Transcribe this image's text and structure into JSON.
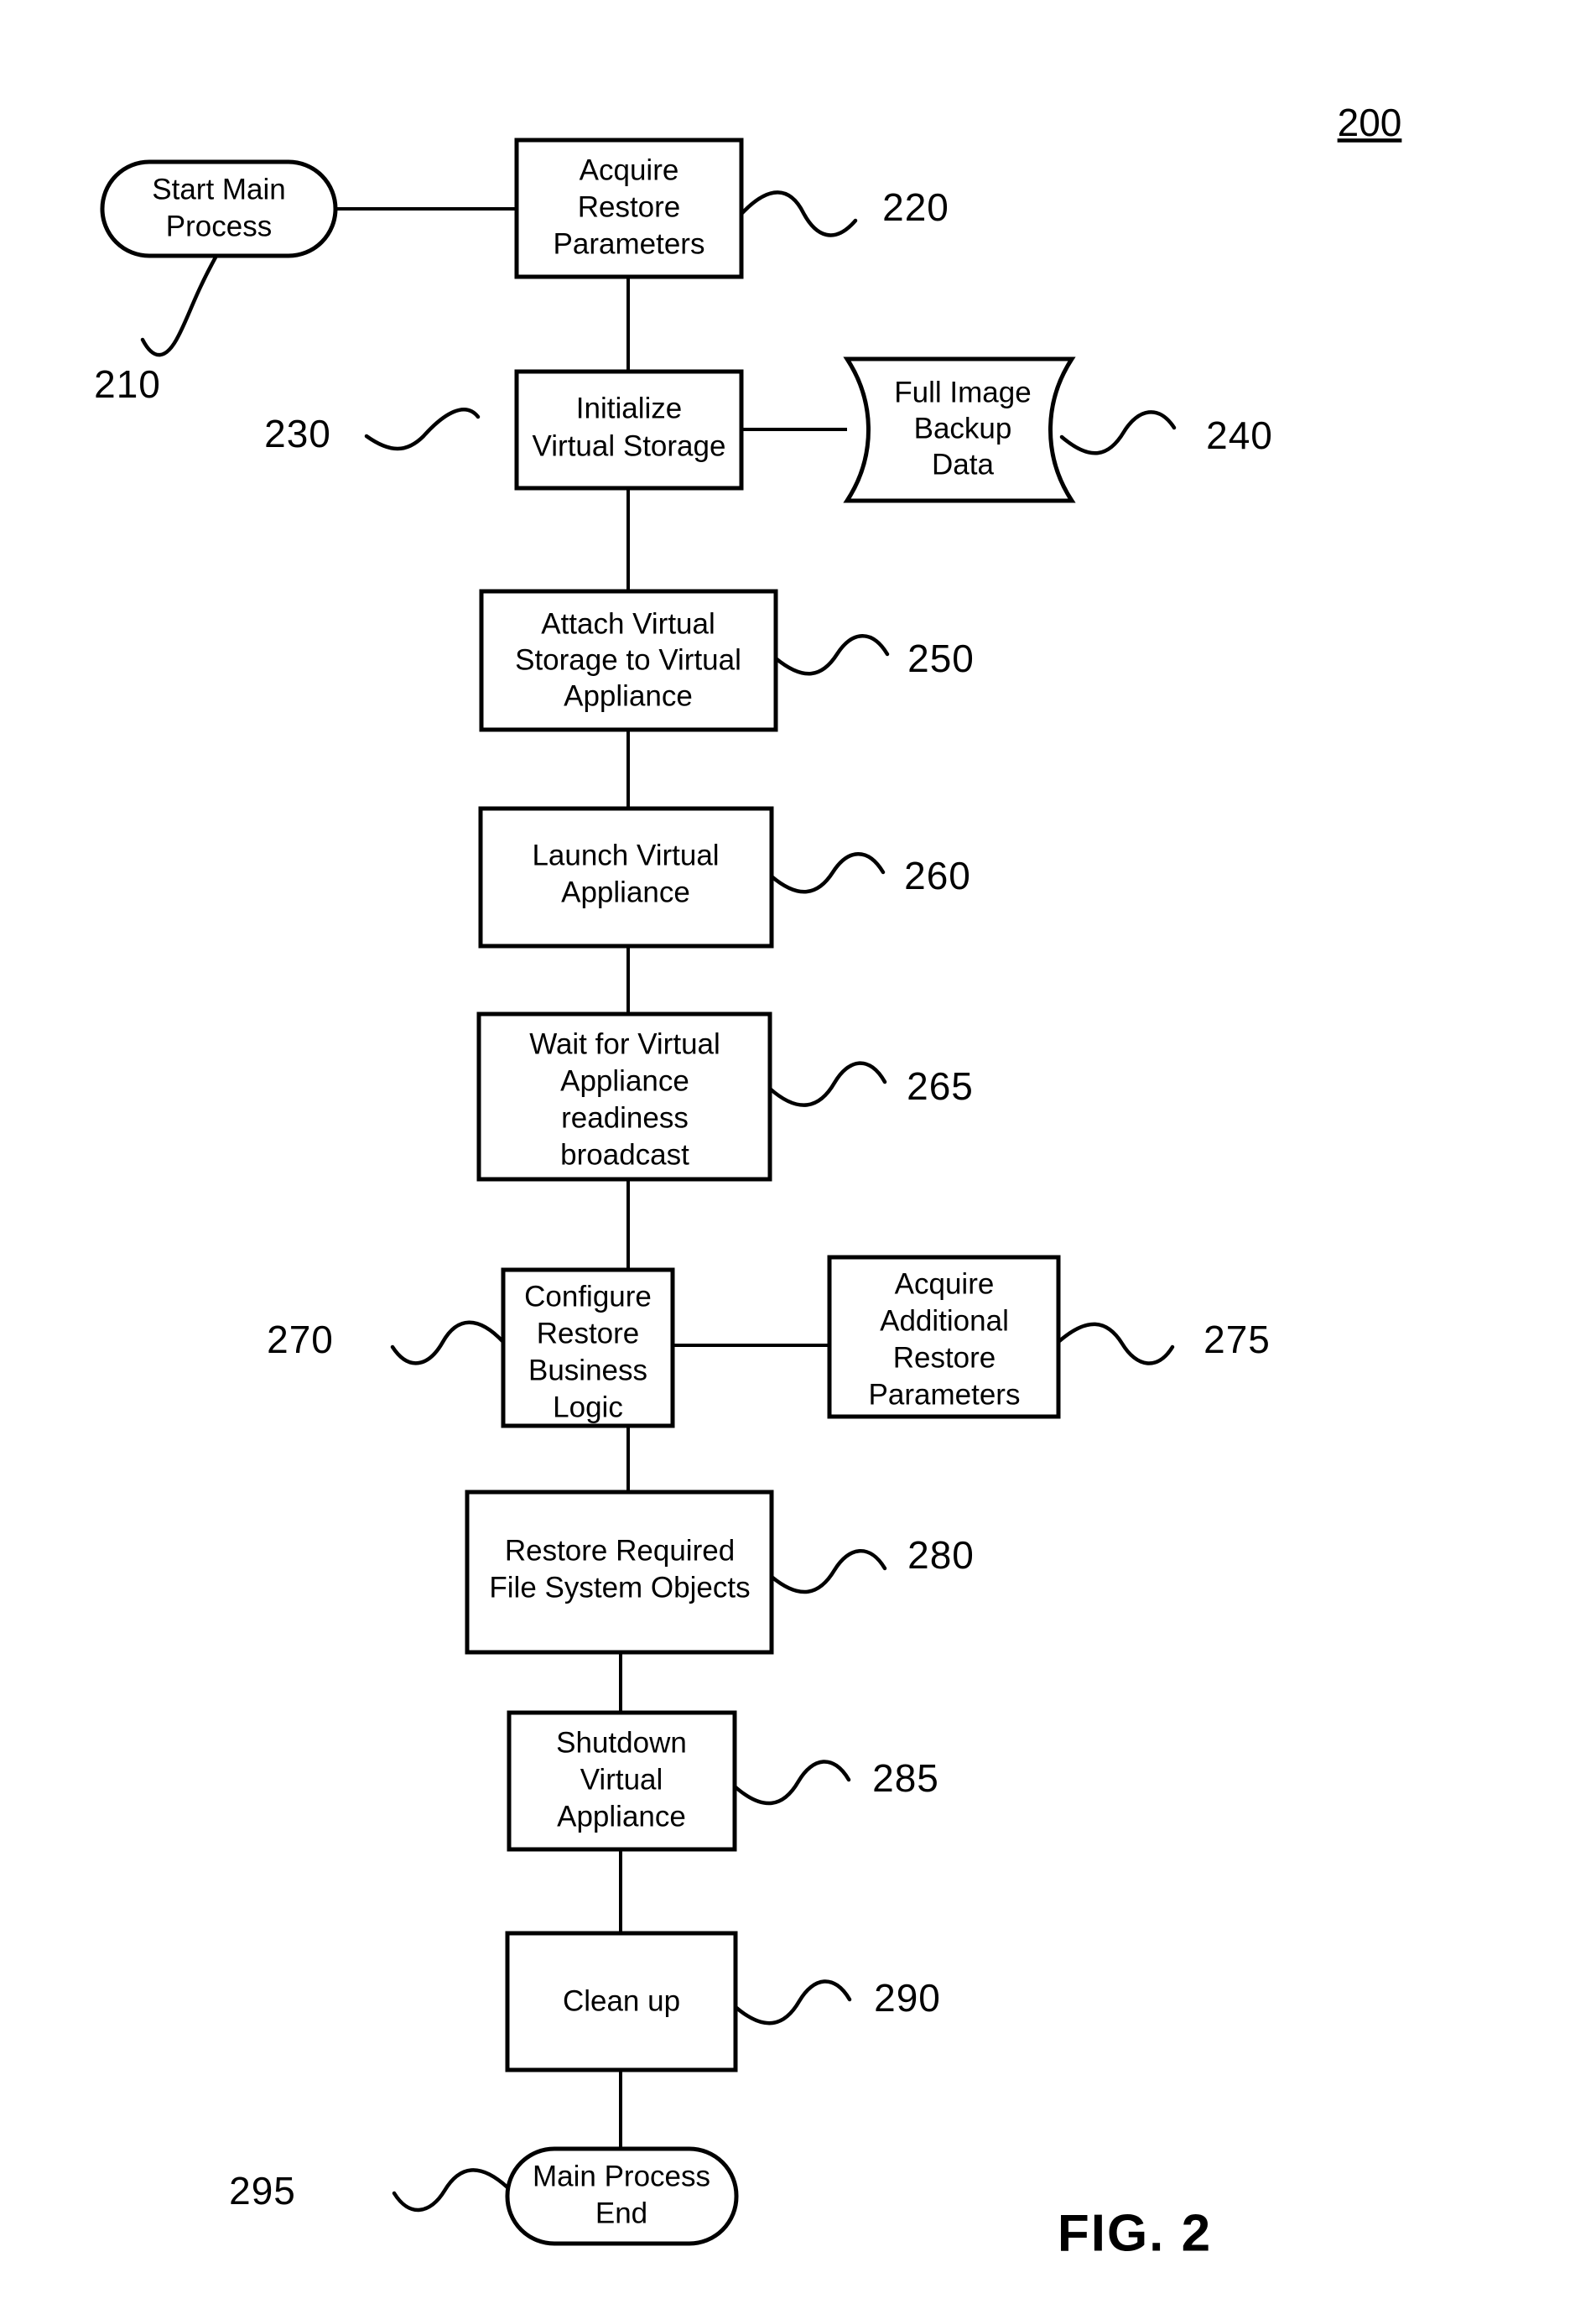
{
  "figure": {
    "caption": "FIG. 2",
    "reference_numeral": "200"
  },
  "nodes": [
    {
      "id": "start",
      "shape": "terminator",
      "ref": "210",
      "lines": [
        "Start Main",
        "Process"
      ]
    },
    {
      "id": "acquire-restore-parameters",
      "shape": "process",
      "ref": "220",
      "lines": [
        "Acquire",
        "Restore",
        "Parameters"
      ]
    },
    {
      "id": "initialize-virtual-storage",
      "shape": "process",
      "ref": "230",
      "lines": [
        "Initialize",
        "Virtual Storage"
      ]
    },
    {
      "id": "full-image-backup-data",
      "shape": "stored-data",
      "ref": "240",
      "lines": [
        "Full Image",
        "Backup",
        "Data"
      ]
    },
    {
      "id": "attach-virtual-storage",
      "shape": "process",
      "ref": "250",
      "lines": [
        "Attach Virtual",
        "Storage to Virtual",
        "Appliance"
      ]
    },
    {
      "id": "launch-virtual-appliance",
      "shape": "process",
      "ref": "260",
      "lines": [
        "Launch Virtual",
        "Appliance"
      ]
    },
    {
      "id": "wait-for-readiness",
      "shape": "process",
      "ref": "265",
      "lines": [
        "Wait for Virtual",
        "Appliance",
        "readiness",
        "broadcast"
      ]
    },
    {
      "id": "configure-restore-business-logic",
      "shape": "process",
      "ref": "270",
      "lines": [
        "Configure",
        "Restore",
        "Business",
        "Logic"
      ]
    },
    {
      "id": "acquire-additional-restore-parameters",
      "shape": "process",
      "ref": "275",
      "lines": [
        "Acquire",
        "Additional",
        "Restore",
        "Parameters"
      ]
    },
    {
      "id": "restore-file-system-objects",
      "shape": "process",
      "ref": "280",
      "lines": [
        "Restore Required",
        "File System Objects"
      ]
    },
    {
      "id": "shutdown-virtual-appliance",
      "shape": "process",
      "ref": "285",
      "lines": [
        "Shutdown",
        "Virtual",
        "Appliance"
      ]
    },
    {
      "id": "clean-up",
      "shape": "process",
      "ref": "290",
      "lines": [
        "Clean up"
      ]
    },
    {
      "id": "end",
      "shape": "terminator",
      "ref": "295",
      "lines": [
        "Main Process",
        "End"
      ]
    }
  ],
  "text": {
    "start_l1": "Start Main",
    "start_l2": "Process",
    "acq_l1": "Acquire",
    "acq_l2": "Restore",
    "acq_l3": "Parameters",
    "init_l1": "Initialize",
    "init_l2": "Virtual Storage",
    "data_l1": "Full Image",
    "data_l2": "Backup",
    "data_l3": "Data",
    "attach_l1": "Attach Virtual",
    "attach_l2": "Storage to Virtual",
    "attach_l3": "Appliance",
    "launch_l1": "Launch Virtual",
    "launch_l2": "Appliance",
    "wait_l1": "Wait for Virtual",
    "wait_l2": "Appliance",
    "wait_l3": "readiness",
    "wait_l4": "broadcast",
    "config_l1": "Configure",
    "config_l2": "Restore",
    "config_l3": "Business",
    "config_l4": "Logic",
    "addl_l1": "Acquire",
    "addl_l2": "Additional",
    "addl_l3": "Restore",
    "addl_l4": "Parameters",
    "restore_l1": "Restore Required",
    "restore_l2": "File System Objects",
    "shutdown_l1": "Shutdown",
    "shutdown_l2": "Virtual",
    "shutdown_l3": "Appliance",
    "cleanup_l1": "Clean up",
    "end_l1": "Main Process",
    "end_l2": "End"
  },
  "refs": {
    "r200": "200",
    "r210": "210",
    "r220": "220",
    "r230": "230",
    "r240": "240",
    "r250": "250",
    "r260": "260",
    "r265": "265",
    "r270": "270",
    "r275": "275",
    "r280": "280",
    "r285": "285",
    "r290": "290",
    "r295": "295",
    "caption": "FIG. 2"
  },
  "colors": {
    "ink": "#000000",
    "paper": "#ffffff"
  }
}
